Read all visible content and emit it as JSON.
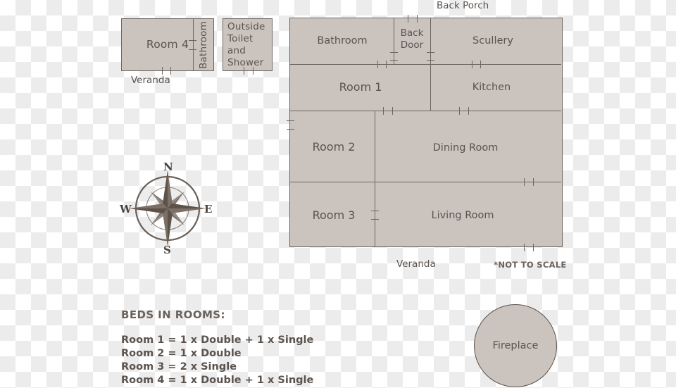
{
  "plan": {
    "not_to_scale_note": "*NOT TO SCALE",
    "back_porch_label": "Back Porch",
    "veranda_left_label": "Veranda",
    "veranda_bottom_label": "Veranda",
    "left_block": {
      "room4_label": "Room 4",
      "bathroom_label": "Bathroom",
      "outside_toilet_label": "Outside\nToilet\nand\nShower"
    },
    "main_rooms": {
      "bathroom": "Bathroom",
      "back_door": "Back\nDoor",
      "scullery": "Scullery",
      "room1": "Room 1",
      "kitchen": "Kitchen",
      "room2": "Room 2",
      "dining_room": "Dining Room",
      "room3": "Room 3",
      "living_room": "Living Room"
    }
  },
  "compass": {
    "north": "N",
    "east": "E",
    "south": "S",
    "west": "W"
  },
  "fireplace": {
    "label": "Fireplace"
  },
  "legend": {
    "title": "BEDS IN ROOMS:",
    "rows": [
      "Room 1 = 1 x Double + 1 x Single",
      "Room 2 = 1 x Double",
      "Room 3 = 2 x Single",
      "Room 4 = 1 x Double + 1 x Single"
    ]
  },
  "colors": {
    "room_fill": "#cbc3be",
    "wall_stroke": "#6e6560",
    "text": "#5b534e",
    "compass": "#6b5f57"
  }
}
